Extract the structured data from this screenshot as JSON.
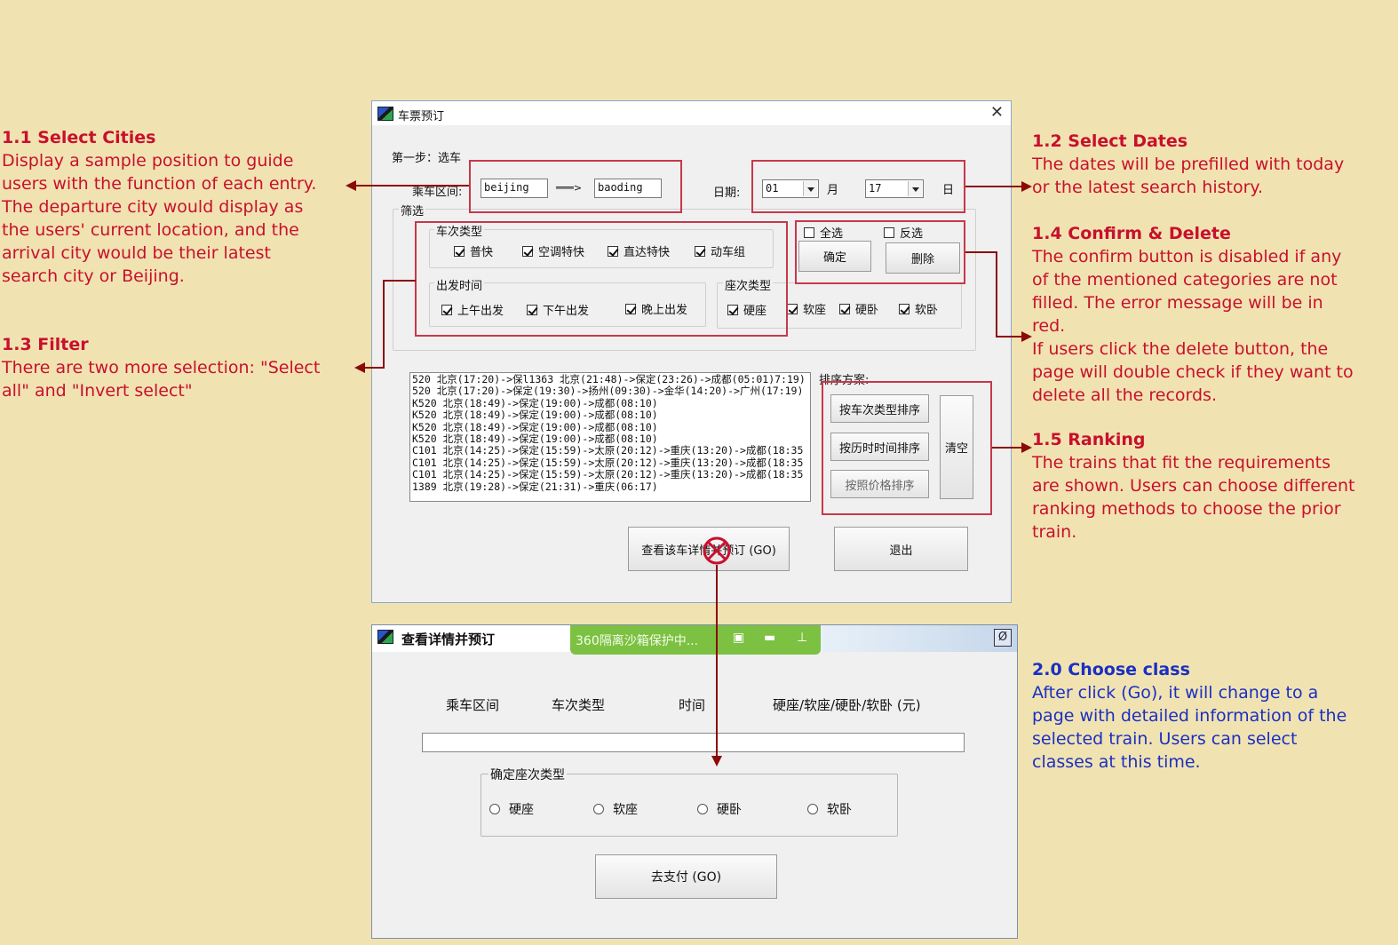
{
  "annotations": {
    "a11": {
      "heading": "1.1 Select Cities",
      "lines": [
        "Display a sample position to guide",
        "users with the function of each entry.",
        "The departure city would display as",
        "the users' current location, and the",
        "arrival city would be their latest",
        "search city or Beijing."
      ]
    },
    "a13": {
      "heading": "1.3 Filter",
      "lines": [
        "There are two more selection: \"Select",
        "all\" and \"Invert select\""
      ]
    },
    "a12": {
      "heading": "1.2 Select Dates",
      "lines": [
        "The dates will be prefilled with today",
        "or the latest search history."
      ]
    },
    "a14": {
      "heading": "1.4 Confirm & Delete",
      "lines": [
        "The confirm button is disabled if any",
        "of the mentioned categories are not",
        "filled. The error message will be in",
        "red.",
        "If users click the delete button, the",
        "page will double check if they want to",
        "delete all the records."
      ]
    },
    "a15": {
      "heading": "1.5 Ranking",
      "lines": [
        "The trains that fit the requirements",
        "are shown. Users can choose different",
        "ranking methods to choose the prior",
        "train."
      ]
    },
    "a20": {
      "heading": "2.0 Choose class",
      "lines": [
        "After click (Go), it will change to a",
        "page with detailed information of the",
        "selected train. Users can select",
        "classes at this time."
      ]
    }
  },
  "win1": {
    "title": "车票预订",
    "step": "第一步：选车",
    "route_label": "乘车区间:",
    "from": "beijing",
    "arrow": "═══>",
    "to": "baoding",
    "date_label": "日期:",
    "month": "01",
    "month_label": "月",
    "day": "17",
    "day_label": "日",
    "filter_title": "筛选",
    "type_group": "车次类型",
    "types": [
      "普快",
      "空调特快",
      "直达特快",
      "动车组"
    ],
    "time_group": "出发时间",
    "times": [
      "上午出发",
      "下午出发",
      "晚上出发"
    ],
    "seat_group": "座次类型",
    "seats": [
      "硬座",
      "软座",
      "硬卧",
      "软卧"
    ],
    "select_all": "全选",
    "invert": "反选",
    "confirm": "确定",
    "delete": "删除",
    "results": [
      "520  北京(17:20)->保l1363 北京(21:48)->保定(23:26)->成都(05:01)7:19)",
      "520  北京(17:20)->保定(19:30)->扬州(09:30)->金华(14:20)->广州(17:19)",
      "K520 北京(18:49)->保定(19:00)->成都(08:10)",
      "K520 北京(18:49)->保定(19:00)->成都(08:10)",
      "K520 北京(18:49)->保定(19:00)->成都(08:10)",
      "K520 北京(18:49)->保定(19:00)->成都(08:10)",
      "C101 北京(14:25)->保定(15:59)->太原(20:12)->重庆(13:20)->成都(18:35",
      "C101 北京(14:25)->保定(15:59)->太原(20:12)->重庆(13:20)->成都(18:35",
      "C101 北京(14:25)->保定(15:59)->太原(20:12)->重庆(13:20)->成都(18:35",
      "1389 北京(19:28)->保定(21:31)->重庆(06:17)"
    ],
    "sort_label": "排序方案:",
    "sort_type": "按车次类型排序",
    "sort_time": "按历时时间排序",
    "sort_price": "按照价格排序",
    "clear": "清空",
    "details": "查看该车详情并预订 (GO)",
    "exit": "退出"
  },
  "win2": {
    "title": "查看详情并预订",
    "sandbox": "360隔离沙箱保护中...",
    "col_route": "乘车区间",
    "col_type": "车次类型",
    "col_time": "时间",
    "col_price": "硬座/软座/硬卧/软卧 (元)",
    "seat_group": "确定座次类型",
    "seats": [
      "硬座",
      "软座",
      "硬卧",
      "软卧"
    ],
    "pay": "去支付 (GO)"
  },
  "colors": {
    "background": "#f1e3b1",
    "annotation_red": "#c8102e",
    "annotation_blue": "#1b2fc2",
    "highlight": "#c7384b",
    "arrow": "#8b0a0a",
    "sandbox_green": "#7cc142"
  }
}
